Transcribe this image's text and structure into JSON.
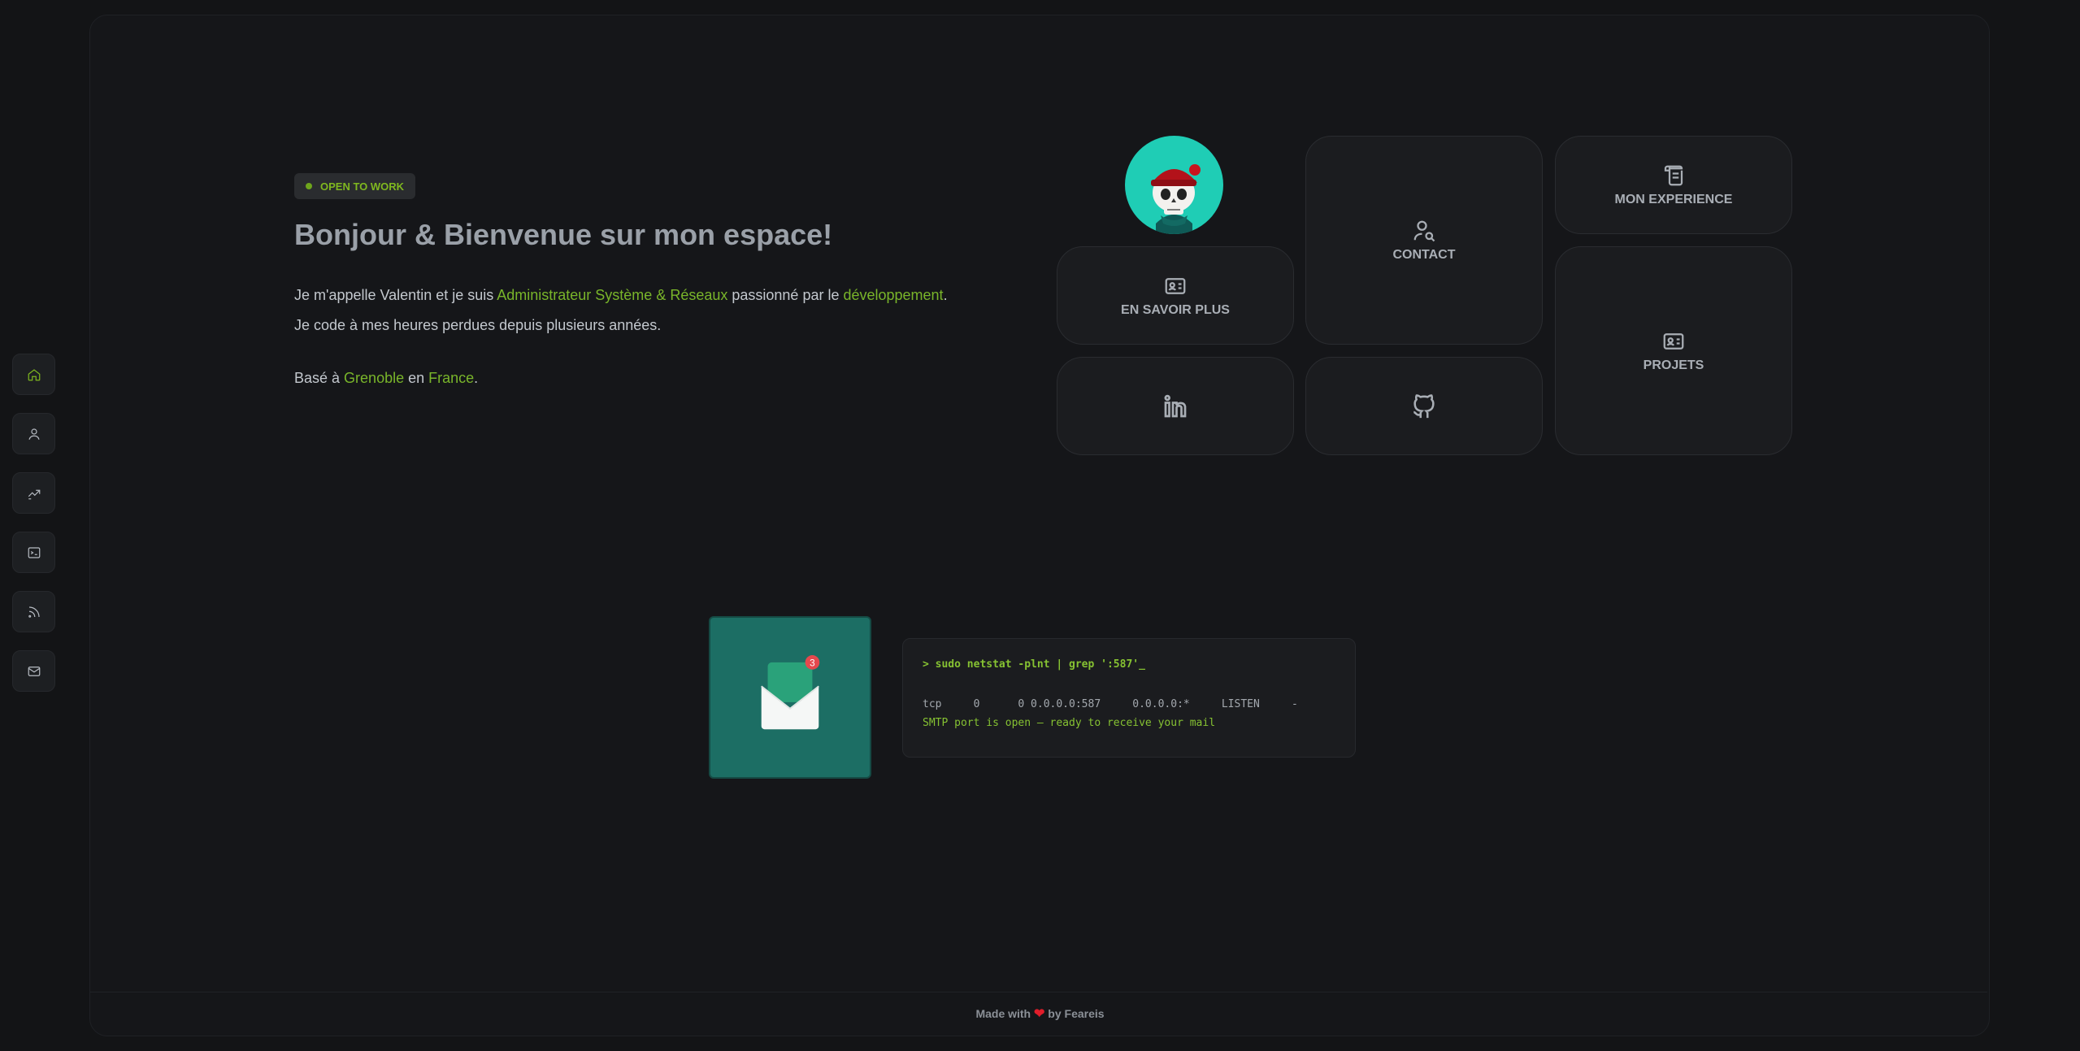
{
  "sidebar": {
    "items": [
      {
        "name": "home",
        "icon": "home-icon",
        "active": true
      },
      {
        "name": "about",
        "icon": "user-icon",
        "active": false
      },
      {
        "name": "experience",
        "icon": "trending-up-icon",
        "active": false
      },
      {
        "name": "projects",
        "icon": "terminal-icon",
        "active": false
      },
      {
        "name": "blog",
        "icon": "rss-icon",
        "active": false
      },
      {
        "name": "contact",
        "icon": "mail-icon",
        "active": false
      }
    ]
  },
  "hero": {
    "badge": "OPEN TO WORK",
    "title": "Bonjour & Bienvenue sur mon espace!",
    "line1_a": "Je m'appelle Valentin et je suis ",
    "line1_role": "Administrateur Système & Réseaux",
    "line1_b": " passionné par le ",
    "line1_dev": "développement",
    "line1_end": ".",
    "line2": "Je code à mes heures perdues depuis plusieurs années.",
    "line3_a": "Basé à ",
    "line3_city": "Grenoble",
    "line3_b": " en ",
    "line3_country": "France",
    "line3_end": "."
  },
  "tiles": {
    "contact": "CONTACT",
    "experience": "MON EXPERIENCE",
    "about": "EN SAVOIR PLUS",
    "projects": "PROJETS"
  },
  "mail": {
    "notification_count": "3"
  },
  "terminal": {
    "command": "> sudo netstat -plnt | grep ':587'_",
    "output": "tcp     0      0 0.0.0.0:587     0.0.0.0:*     LISTEN     -",
    "status": "SMTP port is open — ready to receive your mail"
  },
  "footer": {
    "made_with": "Made with",
    "by": "by Feareis"
  },
  "colors": {
    "accent": "#7fb81f",
    "background": "#131416",
    "mail_bg": "#1c6e64",
    "avatar_bg": "#1fcdb5"
  }
}
